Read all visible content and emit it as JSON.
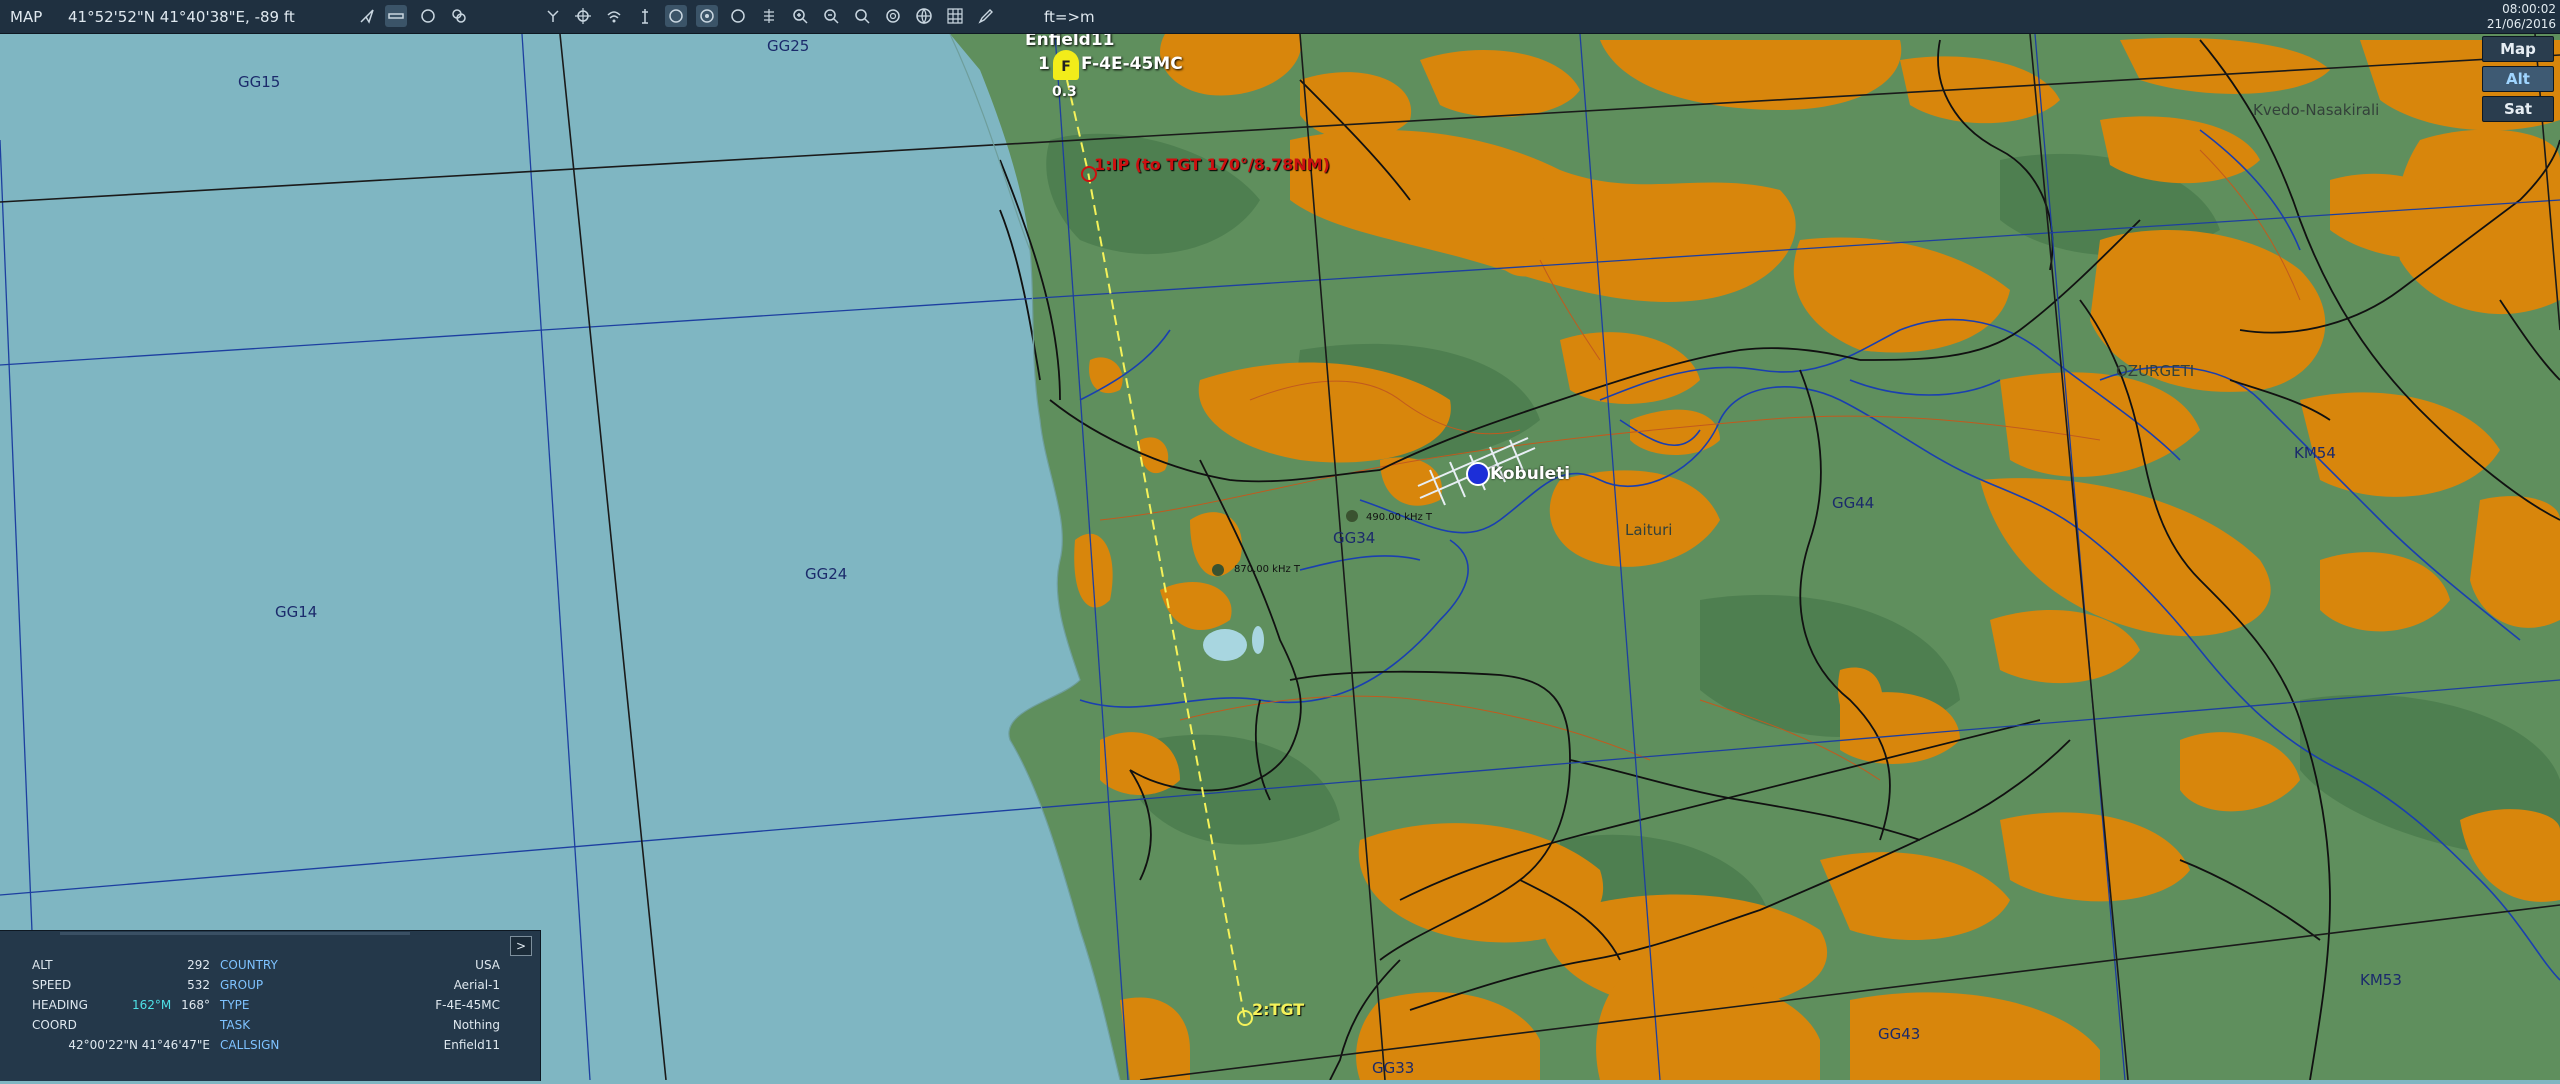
{
  "topbar": {
    "mode": "MAP",
    "coords": "41°52'52\"N 41°40'38\"E, -89 ft",
    "units_toggle": "ft=>m",
    "time": "08:00:02",
    "date": "21/06/2016",
    "tools_left": [
      "pointer-icon",
      "ruler-icon",
      "circle-icon",
      "layers-icon"
    ],
    "tools_right": [
      "fork-icon",
      "crosshair-icon",
      "signal-icon",
      "tower-icon",
      "filter-unit-icon",
      "filter-group-icon",
      "filter-other-icon",
      "snap-icon",
      "zoom-in-icon",
      "zoom-out-icon",
      "zoom-fit-icon",
      "radar-icon",
      "globe-icon",
      "grid-icon",
      "pencil-icon"
    ]
  },
  "layers": {
    "map": "Map",
    "alt": "Alt",
    "sat": "Sat",
    "active": "Alt"
  },
  "grid_labels": [
    "GG15",
    "GG25",
    "GG14",
    "GG24",
    "GG34",
    "GG44",
    "GG43",
    "GG33",
    "KM54",
    "KM53"
  ],
  "towns": [
    "Kvedo-Nasakirali",
    "OZURGETI",
    "Laituri"
  ],
  "airfield": {
    "name": "Kobuleti",
    "freq1": "490.00 kHz T",
    "freq2": "870.00 kHz T"
  },
  "unit": {
    "name": "Enfield11",
    "type": "F-4E-45MC",
    "count": "1",
    "marker": "F",
    "altitude": "0.3"
  },
  "waypoints": {
    "wp1": "1:IP (to TGT 170°/8.78NM)",
    "wp2": "2:TGT"
  },
  "colors": {
    "sea": "#7fb6c2",
    "land": "#5f8f5d",
    "forest": "#4a7a4e",
    "highland": "#d8860c",
    "grid": "#1d3fa0",
    "route": "#f5f25a",
    "ip": "#cc1010"
  },
  "info": {
    "expand_label": ">",
    "alt_label": "ALT",
    "alt_value": "292",
    "speed_label": "SPEED",
    "speed_value": "532",
    "heading_label": "HEADING",
    "heading_mag": "162°M",
    "heading_value": "168°",
    "coord_label": "COORD",
    "coord_value": "42°00'22\"N 41°46'47\"E",
    "country_label": "COUNTRY",
    "country_value": "USA",
    "group_label": "GROUP",
    "group_value": "Aerial-1",
    "type_label": "TYPE",
    "type_value": "F-4E-45MC",
    "task_label": "TASK",
    "task_value": "Nothing",
    "callsign_label": "CALLSIGN",
    "callsign_value": "Enfield11"
  }
}
